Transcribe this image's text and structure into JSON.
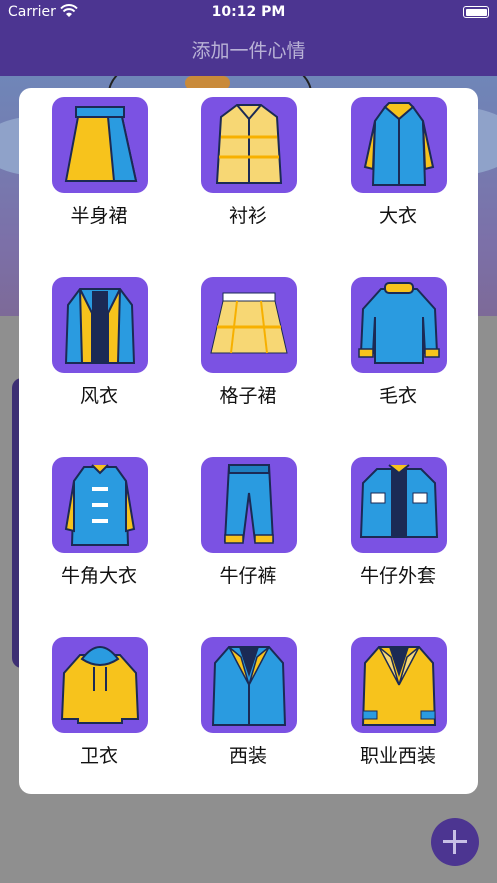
{
  "status_bar": {
    "carrier": "Carrier",
    "time": "10:12 PM"
  },
  "nav": {
    "title": "添加一件心情"
  },
  "colors": {
    "nav": "#4c3591",
    "tile": "#7b52e3",
    "yellow": "#f7c31c",
    "blue": "#2a9be0",
    "navy": "#1b2a55"
  },
  "clothes": [
    {
      "label": "半身裙",
      "icon": "skirt-icon"
    },
    {
      "label": "衬衫",
      "icon": "shirt-icon"
    },
    {
      "label": "大衣",
      "icon": "coat-icon"
    },
    {
      "label": "风衣",
      "icon": "trench-coat-icon"
    },
    {
      "label": "格子裙",
      "icon": "plaid-skirt-icon"
    },
    {
      "label": "毛衣",
      "icon": "sweater-icon"
    },
    {
      "label": "牛角大衣",
      "icon": "toggle-coat-icon"
    },
    {
      "label": "牛仔裤",
      "icon": "jeans-icon"
    },
    {
      "label": "牛仔外套",
      "icon": "denim-jacket-icon"
    },
    {
      "label": "卫衣",
      "icon": "hoodie-icon"
    },
    {
      "label": "西装",
      "icon": "suit-icon"
    },
    {
      "label": "职业西装",
      "icon": "business-suit-icon"
    }
  ]
}
